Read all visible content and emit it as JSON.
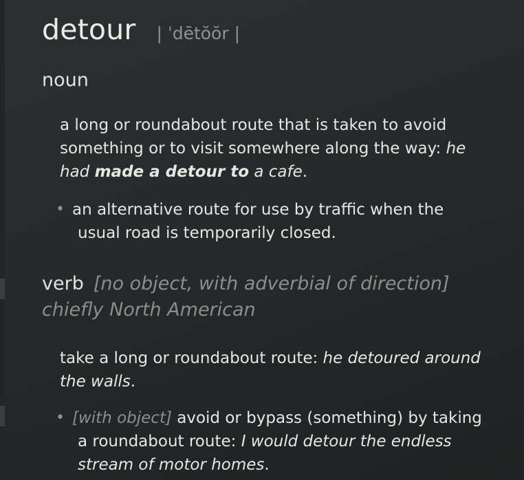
{
  "entry": {
    "headword": "detour",
    "pronunciation": "| ˈdētŏŏr |"
  },
  "noun": {
    "label": "noun",
    "sense1": {
      "definition": "a long or roundabout route that is taken to avoid something or to visit somewhere along the way: ",
      "example_pre": "he had ",
      "example_bold": "made a detour to",
      "example_post": " a cafe",
      "end": "."
    },
    "sub1": {
      "bullet": "•",
      "line1": "an alternative route for use by traffic when the",
      "line2": "usual road is temporarily closed."
    }
  },
  "verb": {
    "label": "verb",
    "grammar": "[no object, with adverbial of direction]",
    "region": "chiefly North American",
    "sense1": {
      "definition": "take a long or roundabout route: ",
      "example": "he detoured around the walls",
      "end": "."
    },
    "sub1": {
      "bullet": "•",
      "grammar": "[with object]",
      "definition": " avoid or bypass (something) by taking",
      "line2_def": "a roundabout route: ",
      "example_line2": "I would detour the endless",
      "example_line3": "stream of motor homes",
      "end": "."
    }
  }
}
